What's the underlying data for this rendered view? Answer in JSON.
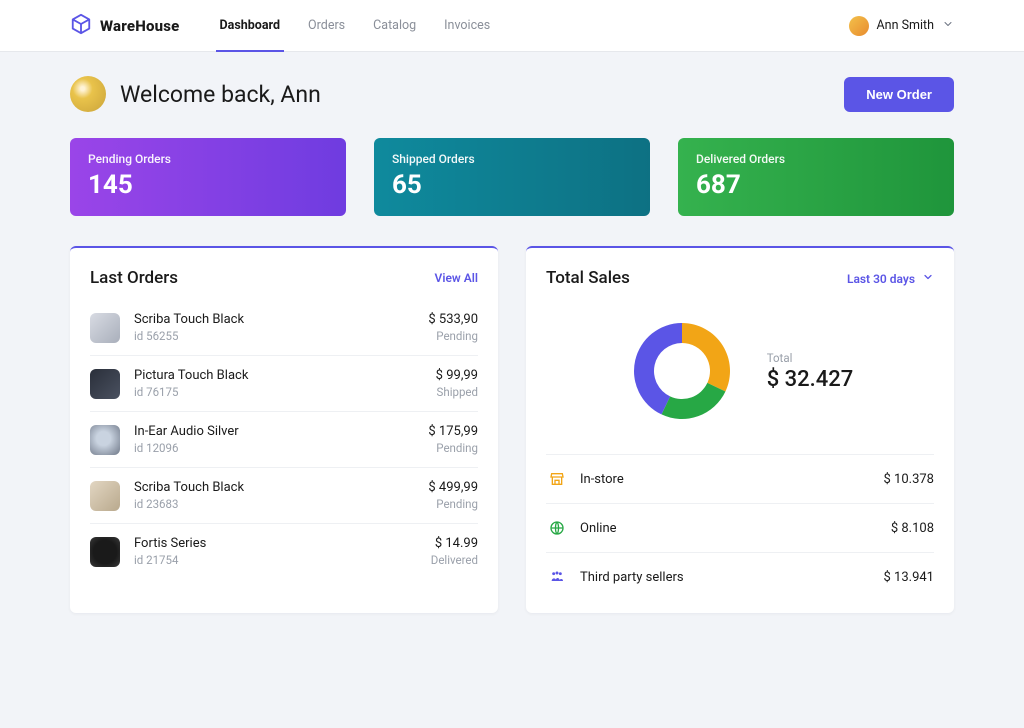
{
  "brand": {
    "name": "WareHouse"
  },
  "nav": {
    "items": [
      {
        "label": "Dashboard",
        "active": true
      },
      {
        "label": "Orders",
        "active": false
      },
      {
        "label": "Catalog",
        "active": false
      },
      {
        "label": "Invoices",
        "active": false
      }
    ]
  },
  "user": {
    "name": "Ann Smith"
  },
  "welcome": {
    "text": "Welcome back, Ann",
    "new_order_label": "New Order"
  },
  "stats": [
    {
      "label": "Pending Orders",
      "value": "145",
      "variant": "purple"
    },
    {
      "label": "Shipped Orders",
      "value": "65",
      "variant": "teal"
    },
    {
      "label": "Delivered Orders",
      "value": "687",
      "variant": "green"
    }
  ],
  "last_orders": {
    "title": "Last Orders",
    "view_all_label": "View All",
    "rows": [
      {
        "name": "Scriba Touch Black",
        "id": "id 56255",
        "price": "$ 533,90",
        "status": "Pending"
      },
      {
        "name": "Pictura Touch Black",
        "id": "id 76175",
        "price": "$ 99,99",
        "status": "Shipped"
      },
      {
        "name": "In-Ear Audio Silver",
        "id": "id 12096",
        "price": "$ 175,99",
        "status": "Pending"
      },
      {
        "name": "Scriba Touch Black",
        "id": "id 23683",
        "price": "$ 499,99",
        "status": "Pending"
      },
      {
        "name": "Fortis Series",
        "id": "id 21754",
        "price": "$ 14.99",
        "status": "Delivered"
      }
    ]
  },
  "total_sales": {
    "title": "Total Sales",
    "range_label": "Last 30 days",
    "total_label": "Total",
    "total_value": "$ 32.427",
    "breakdown": [
      {
        "icon": "store-icon",
        "label": "In-store",
        "amount": "$ 10.378",
        "color": "#f2a516"
      },
      {
        "icon": "globe-icon",
        "label": "Online",
        "amount": "$ 8.108",
        "color": "#27a845"
      },
      {
        "icon": "people-icon",
        "label": "Third party sellers",
        "amount": "$ 13.941",
        "color": "#5b55e6"
      }
    ]
  },
  "chart_data": {
    "type": "pie",
    "title": "Total Sales breakdown",
    "series": [
      {
        "name": "In-store",
        "value": 10378,
        "color": "#f2a516"
      },
      {
        "name": "Online",
        "value": 8108,
        "color": "#27a845"
      },
      {
        "name": "Third party sellers",
        "value": 13941,
        "color": "#5b55e6"
      }
    ],
    "total": 32427
  }
}
